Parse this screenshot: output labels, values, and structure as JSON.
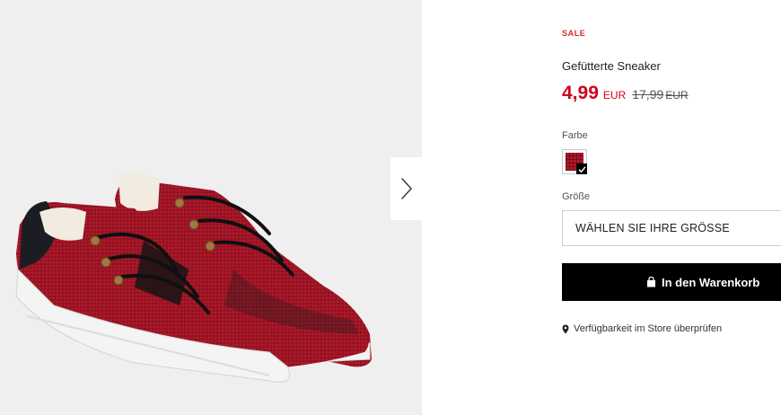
{
  "product": {
    "sale_badge": "SALE",
    "name": "Gefütterte Sneaker",
    "price_current": "4,99",
    "price_currency": "EUR",
    "price_old": "17,99",
    "price_old_currency": "EUR"
  },
  "color": {
    "label": "Farbe",
    "selected_swatch": "red-plaid",
    "swatch_color": "#b5162a"
  },
  "size": {
    "label": "Größe",
    "select_placeholder": "WÄHLEN SIE IHRE GRÖSSE"
  },
  "cart": {
    "button_label": "In den Warenkorb",
    "icon": "shopping-bag-icon"
  },
  "store": {
    "availability_link": "Verfügbarkeit im Store überprüfen",
    "icon": "location-pin-icon"
  },
  "gallery": {
    "next_icon": "chevron-right-icon"
  },
  "colors": {
    "sale_red": "#d0021b",
    "button_black": "#000000"
  }
}
